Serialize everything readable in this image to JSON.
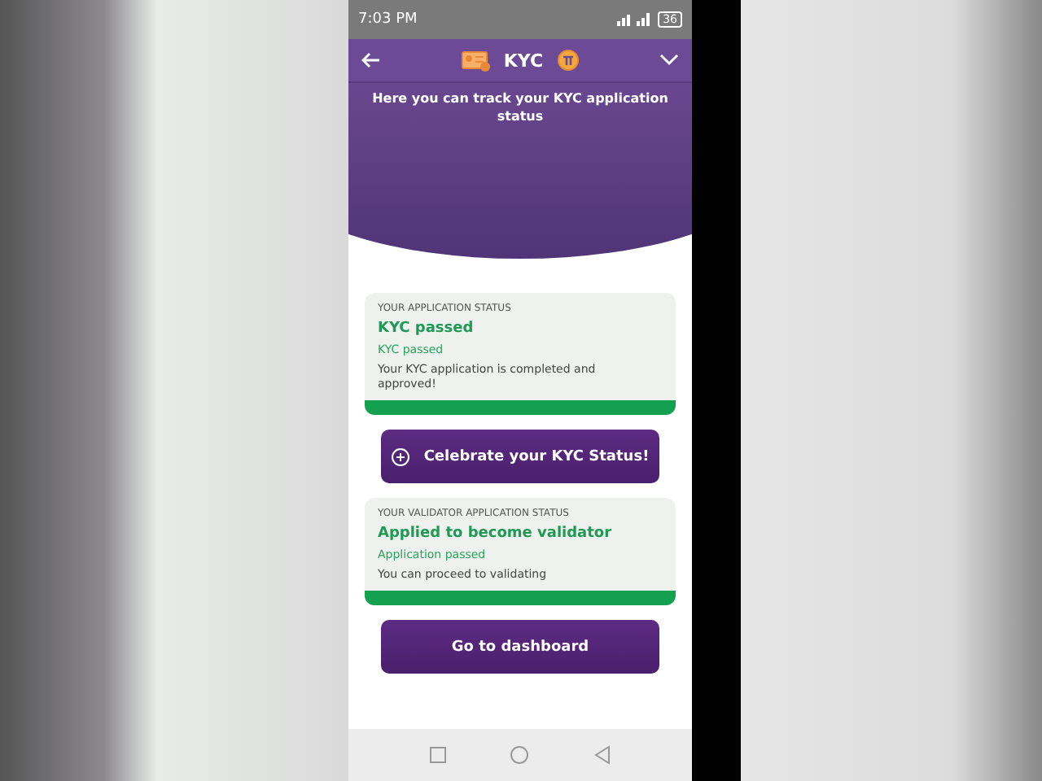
{
  "status_bar": {
    "time": "7:03 PM",
    "battery": "36"
  },
  "header": {
    "title": "KYC"
  },
  "intro": "Here you can track your KYC application status",
  "cards": [
    {
      "caption": "YOUR APPLICATION STATUS",
      "heading": "KYC passed",
      "status": "KYC passed",
      "message": "Your KYC application is completed and approved!",
      "button": {
        "label": "Celebrate your KYC Status!",
        "kind": "plus"
      }
    },
    {
      "caption": "YOUR VALIDATOR APPLICATION STATUS",
      "heading": "Applied to become validator",
      "status": "Application passed",
      "message": "You can proceed to validating",
      "button": {
        "label": "Go to dashboard",
        "kind": "plain"
      }
    }
  ]
}
